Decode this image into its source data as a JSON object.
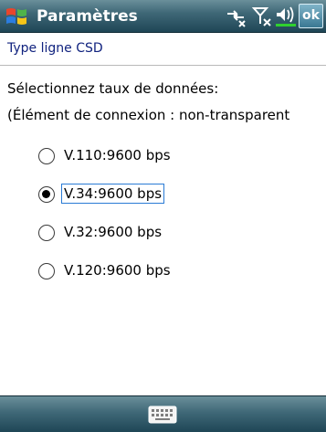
{
  "titlebar": {
    "title": "Paramètres",
    "ok_label": "ok",
    "icons": [
      "windows-start-icon",
      "connectivity-icon",
      "signal-off-icon",
      "volume-icon",
      "battery-icon"
    ],
    "colors": {
      "bar": "#3f6877",
      "ok": "#3a7893",
      "battery": "#2fd12f"
    }
  },
  "header": {
    "title": "Type ligne CSD",
    "title_color": "#11237f"
  },
  "content": {
    "instruction_line1": "Sélectionnez taux de données:",
    "instruction_line2": "(Élément de connexion : non-transparent",
    "options": [
      {
        "label": "V.110:9600 bps",
        "selected": false
      },
      {
        "label": "V.34:9600 bps",
        "selected": true
      },
      {
        "label": "V.32:9600 bps",
        "selected": false
      },
      {
        "label": "V.120:9600 bps",
        "selected": false
      }
    ]
  },
  "bottombar": {
    "icons": [
      "keyboard-icon"
    ]
  }
}
